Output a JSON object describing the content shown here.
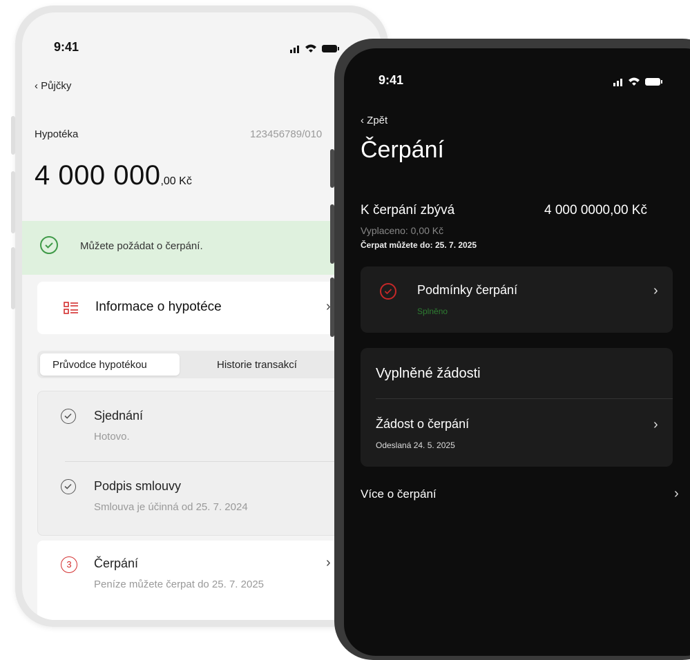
{
  "light": {
    "status_time": "9:41",
    "back_label": "Půjčky",
    "loan_name": "Hypotéka",
    "loan_number": "123456789/010",
    "amount_main": "4 000 000",
    "amount_suffix": ",00 Kč",
    "banner_text": "Můžete požádat o čerpání.",
    "info_label": "Informace o hypotéce",
    "tabs": [
      "Průvodce hypotékou",
      "Historie transakcí"
    ],
    "steps": [
      {
        "title": "Sjednání",
        "subtitle": "Hotovo."
      },
      {
        "title": "Podpis smlouvy",
        "subtitle": "Smlouva je účinná od 25. 7. 2024"
      },
      {
        "number": "3",
        "title": "Čerpání",
        "subtitle": "Peníze můžete čerpat do 25. 7. 2025"
      }
    ]
  },
  "dark": {
    "status_time": "9:41",
    "back_label": "Zpět",
    "title": "Čerpání",
    "remaining_label": "K čerpání zbývá",
    "remaining_value": "4 000 0000,00 Kč",
    "paid_out": "Vyplaceno: 0,00 Kč",
    "deadline": "Čerpat můžete do: 25. 7. 2025",
    "conditions_title": "Podmínky čerpání",
    "conditions_status": "Splněno",
    "requests_heading": "Vyplněné žádosti",
    "request_title": "Žádost o čerpání",
    "request_date": "Odeslaná 24. 5. 2025",
    "more_label": "Více o čerpání"
  },
  "colors": {
    "accent_red": "#d32f2f",
    "success_green": "#3f9a48",
    "banner_bg": "#dff1de",
    "dark_bg": "#0d0d0d"
  }
}
